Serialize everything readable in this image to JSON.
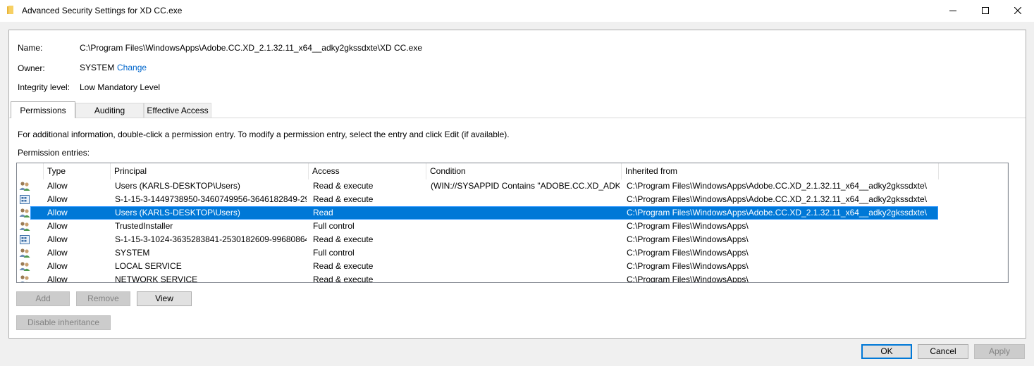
{
  "window": {
    "title": "Advanced Security Settings for XD CC.exe"
  },
  "info": {
    "name_label": "Name:",
    "name_value": "C:\\Program Files\\WindowsApps\\Adobe.CC.XD_2.1.32.11_x64__adky2gkssdxte\\XD CC.exe",
    "owner_label": "Owner:",
    "owner_value": "SYSTEM",
    "owner_change": "Change",
    "integrity_label": "Integrity level:",
    "integrity_value": "Low Mandatory Level"
  },
  "tabs": [
    {
      "label": "Permissions",
      "active": true
    },
    {
      "label": "Auditing",
      "active": false
    },
    {
      "label": "Effective Access",
      "active": false
    }
  ],
  "permissions": {
    "hint": "For additional information, double-click a permission entry. To modify a permission entry, select the entry and click Edit (if available).",
    "entries_label": "Permission entries:",
    "columns": [
      "Type",
      "Principal",
      "Access",
      "Condition",
      "Inherited from"
    ],
    "rows": [
      {
        "icon": "users-icon",
        "type": "Allow",
        "principal": "Users (KARLS-DESKTOP\\Users)",
        "access": "Read & execute",
        "condition": "(WIN://SYSAPPID Contains \"ADOBE.CC.XD_ADK...",
        "inherited": "C:\\Program Files\\WindowsApps\\Adobe.CC.XD_2.1.32.11_x64__adky2gkssdxte\\"
      },
      {
        "icon": "app-package-icon",
        "type": "Allow",
        "principal": "S-1-15-3-1449738950-3460749956-3646182849-29...",
        "access": "Read & execute",
        "condition": "",
        "inherited": "C:\\Program Files\\WindowsApps\\Adobe.CC.XD_2.1.32.11_x64__adky2gkssdxte\\"
      },
      {
        "icon": "users-icon",
        "type": "Allow",
        "principal": "Users (KARLS-DESKTOP\\Users)",
        "access": "Read",
        "condition": "",
        "inherited": "C:\\Program Files\\WindowsApps\\Adobe.CC.XD_2.1.32.11_x64__adky2gkssdxte\\",
        "selected": true
      },
      {
        "icon": "users-icon",
        "type": "Allow",
        "principal": "TrustedInstaller",
        "access": "Full control",
        "condition": "",
        "inherited": "C:\\Program Files\\WindowsApps\\"
      },
      {
        "icon": "app-package-icon",
        "type": "Allow",
        "principal": "S-1-15-3-1024-3635283841-2530182609-99680864...",
        "access": "Read & execute",
        "condition": "",
        "inherited": "C:\\Program Files\\WindowsApps\\"
      },
      {
        "icon": "users-icon",
        "type": "Allow",
        "principal": "SYSTEM",
        "access": "Full control",
        "condition": "",
        "inherited": "C:\\Program Files\\WindowsApps\\"
      },
      {
        "icon": "users-icon",
        "type": "Allow",
        "principal": "LOCAL SERVICE",
        "access": "Read & execute",
        "condition": "",
        "inherited": "C:\\Program Files\\WindowsApps\\"
      },
      {
        "icon": "users-icon",
        "type": "Allow",
        "principal": "NETWORK SERVICE",
        "access": "Read & execute",
        "condition": "",
        "inherited": "C:\\Program Files\\WindowsApps\\"
      }
    ]
  },
  "buttons": {
    "add": "Add",
    "remove": "Remove",
    "view": "View",
    "disable_inheritance": "Disable inheritance",
    "ok": "OK",
    "cancel": "Cancel",
    "apply": "Apply"
  },
  "colors": {
    "selection": "#0078d7",
    "link": "#0066cc"
  }
}
